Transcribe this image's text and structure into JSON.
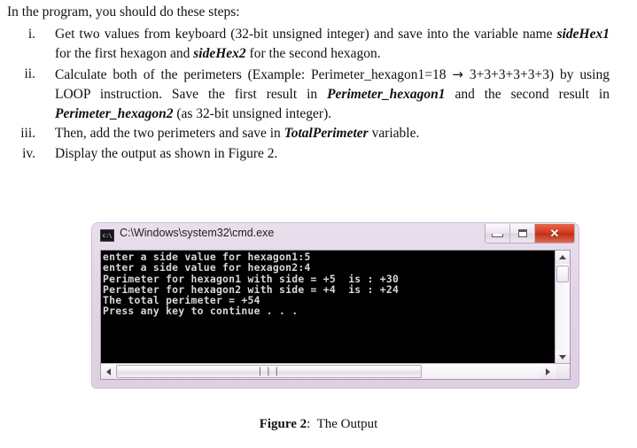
{
  "document": {
    "intro": "In the program, you should do these steps:",
    "steps": [
      {
        "numeral": "i.",
        "parts": [
          {
            "t": "Get two values from keyboard (32-bit unsigned integer) and save into the variable name ",
            "s": "normal"
          },
          {
            "t": "sideHex1",
            "s": "bold-italic"
          },
          {
            "t": " for the first hexagon and ",
            "s": "normal"
          },
          {
            "t": "sideHex2",
            "s": "bold-italic"
          },
          {
            "t": " for the second hexagon.",
            "s": "normal"
          }
        ]
      },
      {
        "numeral": "ii.",
        "parts": [
          {
            "t": "Calculate both of the perimeters (Example: Perimeter_hexagon1=18 ",
            "s": "normal"
          },
          {
            "t": "→",
            "s": "arrow"
          },
          {
            "t": " 3+3+3+3+3+3) by using LOOP instruction. Save the first result in ",
            "s": "normal"
          },
          {
            "t": "Perimeter_hexagon1",
            "s": "bold-italic"
          },
          {
            "t": " and the second result in ",
            "s": "normal"
          },
          {
            "t": "Perimeter_hexagon2",
            "s": "bold-italic"
          },
          {
            "t": " (as 32-bit unsigned integer).",
            "s": "normal"
          }
        ]
      },
      {
        "numeral": "iii.",
        "parts": [
          {
            "t": "Then, add the two perimeters and save in ",
            "s": "normal"
          },
          {
            "t": "TotalPerimeter",
            "s": "bold-italic"
          },
          {
            "t": " variable.",
            "s": "normal"
          }
        ]
      },
      {
        "numeral": "iv.",
        "parts": [
          {
            "t": "Display the output as shown in Figure 2.",
            "s": "normal"
          }
        ]
      }
    ]
  },
  "cmd_window": {
    "icon_label": "c:\\",
    "title": "C:\\Windows\\system32\\cmd.exe",
    "buttons": {
      "minimize": "–",
      "maximize": "□",
      "close": "✕"
    },
    "console_lines": [
      "enter a side value for hexagon1:5",
      "enter a side value for hexagon2:4",
      "Perimeter for hexagon1 with side = +5  is : +30",
      "Perimeter for hexagon2 with side = +4  is : +24",
      "The total perimeter = +54",
      "Press any key to continue . . ."
    ],
    "scrollbar_grip": "❘❘❘",
    "colors": {
      "frame": "#e2d4e6",
      "console_bg": "#000000",
      "console_fg": "#d8d8d8",
      "close_button": "#d33a1c"
    }
  },
  "caption": {
    "label": "Figure 2",
    "separator": ":",
    "text": "The Output"
  }
}
